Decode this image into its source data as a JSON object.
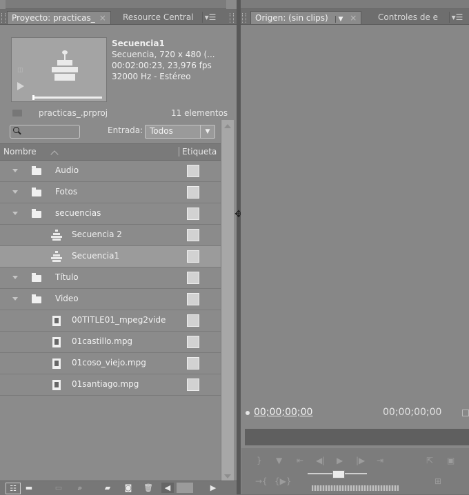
{
  "project_panel": {
    "tabs": [
      {
        "label": "Proyecto: practicas_",
        "close": "×"
      },
      {
        "label": "Resource Central"
      }
    ],
    "menu_glyph": "▾☰",
    "preview": {
      "name": "Secuencia1",
      "line1": "Secuencia, 720 x 480 (...",
      "line2": "00:02:00:23, 23,976 fps",
      "line3": "32000 Hz - Estéreo"
    },
    "project_file": "practicas_.prproj",
    "item_count": "11 elementos",
    "search": {
      "placeholder": ""
    },
    "entrada": {
      "label": "Entrada:",
      "value": "Todos"
    },
    "columns": {
      "name": "Nombre",
      "label": "Etiqueta"
    },
    "items": [
      {
        "label": "Audio",
        "type": "folder"
      },
      {
        "label": "Fotos",
        "type": "folder"
      },
      {
        "label": "secuencias",
        "type": "folder"
      },
      {
        "label": "Secuencia 2",
        "type": "sequence"
      },
      {
        "label": "Secuencia1",
        "type": "sequence",
        "selected": true
      },
      {
        "label": "Título",
        "type": "folder"
      },
      {
        "label": "Video",
        "type": "folder"
      },
      {
        "label": "00TITLE01_mpeg2vide",
        "type": "clip"
      },
      {
        "label": "01castillo.mpg",
        "type": "clip"
      },
      {
        "label": "01coso_viejo.mpg",
        "type": "clip"
      },
      {
        "label": "01santiago.mpg",
        "type": "clip"
      }
    ],
    "toolbar_icons": [
      "list-view-icon",
      "icon-view-icon",
      "automate-icon",
      "find-icon",
      "new-bin-icon",
      "new-item-icon",
      "delete-icon",
      "scroll-left-icon",
      "scroll-right-icon"
    ]
  },
  "source_panel": {
    "tabs": [
      {
        "label": "Origen: (sin clips)",
        "close": "×"
      },
      {
        "label": "Controles de e"
      }
    ],
    "menu_glyph": "▾☰",
    "timecode_current": "00;00;00;00",
    "timecode_duration": "00;00;00;00"
  }
}
